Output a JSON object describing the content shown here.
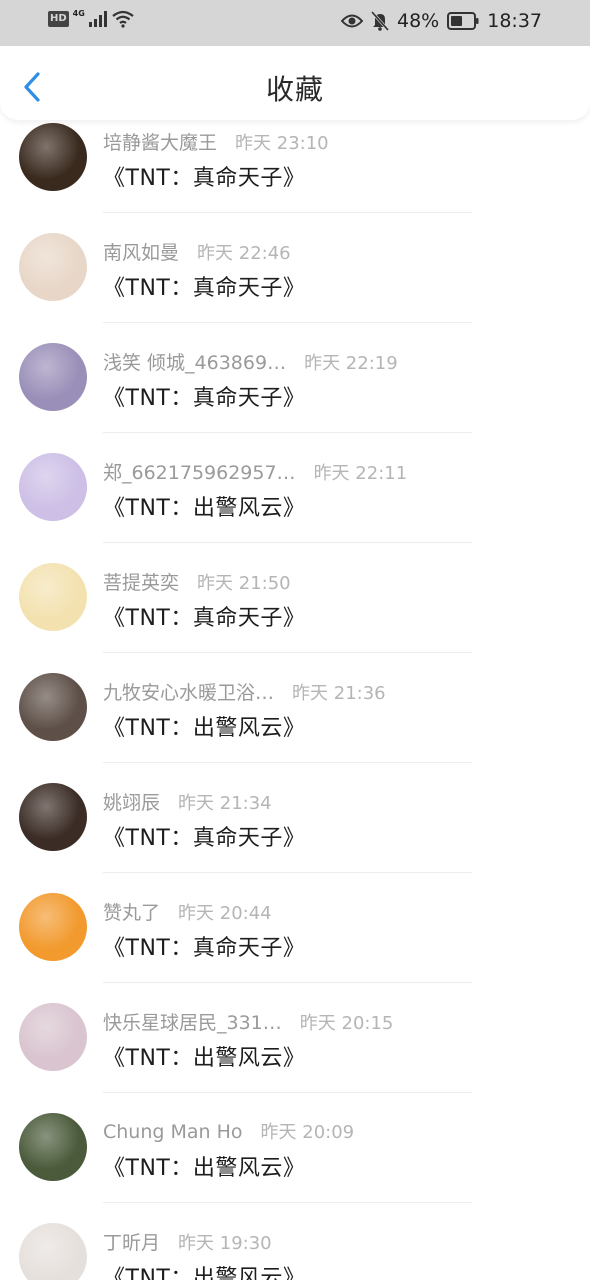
{
  "status_bar": {
    "hd": "HD",
    "network": "4G",
    "battery": "48%",
    "time": "18:37"
  },
  "header": {
    "title": "收藏",
    "accent_color": "#2f8fe6"
  },
  "items": [
    {
      "name": "培静酱大魔王",
      "time": "昨天 23:10",
      "subject": "《TNT：真命天子》",
      "avatar_color": "#3a2a1e"
    },
    {
      "name": "南风如曼",
      "time": "昨天 22:46",
      "subject": "《TNT：真命天子》",
      "avatar_color": "#e8d7c8"
    },
    {
      "name": "浅笑 倾城_463869…",
      "time": "昨天 22:19",
      "subject": "《TNT：真命天子》",
      "avatar_color": "#9a8fb8"
    },
    {
      "name": "郑_662175962957…",
      "time": "昨天 22:11",
      "subject": "《TNT：出警风云》",
      "avatar_color": "#cdbfe6"
    },
    {
      "name": "菩提英奕",
      "time": "昨天 21:50",
      "subject": "《TNT：真命天子》",
      "avatar_color": "#f3e2b0"
    },
    {
      "name": "九牧安心水暖卫浴…",
      "time": "昨天 21:36",
      "subject": "《TNT：出警风云》",
      "avatar_color": "#5e5048"
    },
    {
      "name": "姚翊辰",
      "time": "昨天 21:34",
      "subject": "《TNT：真命天子》",
      "avatar_color": "#3b2c25"
    },
    {
      "name": "赞丸了",
      "time": "昨天 20:44",
      "subject": "《TNT：真命天子》",
      "avatar_color": "#f29a2e"
    },
    {
      "name": "快乐星球居民_331…",
      "time": "昨天 20:15",
      "subject": "《TNT：出警风云》",
      "avatar_color": "#d9c4cf"
    },
    {
      "name": "Chung Man Ho",
      "time": "昨天 20:09",
      "subject": "《TNT：出警风云》",
      "avatar_color": "#4a5a3a"
    },
    {
      "name": "丁昕月",
      "time": "昨天 19:30",
      "subject": "《TNT：出警风云》",
      "avatar_color": "#e6e0dc"
    }
  ]
}
